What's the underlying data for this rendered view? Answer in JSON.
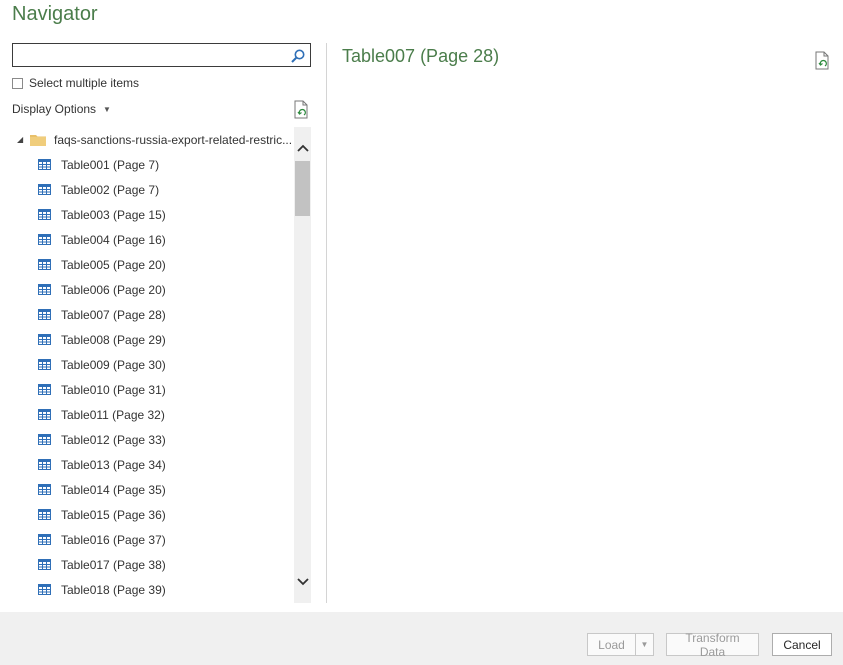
{
  "window": {
    "title": "Navigator"
  },
  "search": {
    "value": "",
    "placeholder": ""
  },
  "options": {
    "select_multiple_label": "Select multiple items",
    "select_multiple_checked": false,
    "display_options_label": "Display Options"
  },
  "tree": {
    "folder_label": "faqs-sanctions-russia-export-related-restric...",
    "items": [
      {
        "label": "Table001 (Page 7)"
      },
      {
        "label": "Table002 (Page 7)"
      },
      {
        "label": "Table003 (Page 15)"
      },
      {
        "label": "Table004 (Page 16)"
      },
      {
        "label": "Table005 (Page 20)"
      },
      {
        "label": "Table006 (Page 20)"
      },
      {
        "label": "Table007 (Page 28)"
      },
      {
        "label": "Table008 (Page 29)"
      },
      {
        "label": "Table009 (Page 30)"
      },
      {
        "label": "Table010 (Page 31)"
      },
      {
        "label": "Table011 (Page 32)"
      },
      {
        "label": "Table012 (Page 33)"
      },
      {
        "label": "Table013 (Page 34)"
      },
      {
        "label": "Table014 (Page 35)"
      },
      {
        "label": "Table015 (Page 36)"
      },
      {
        "label": "Table016 (Page 37)"
      },
      {
        "label": "Table017 (Page 38)"
      },
      {
        "label": "Table018 (Page 39)"
      }
    ]
  },
  "preview": {
    "title": "Table007 (Page 28)"
  },
  "footer": {
    "load_label": "Load",
    "transform_label": "Transform Data",
    "cancel_label": "Cancel"
  },
  "colors": {
    "accent_green": "#4b7d4b",
    "table_icon_blue": "#2f6fb7",
    "folder_yellow": "#e8c06a"
  },
  "icons": {
    "search": "search-icon",
    "refresh": "refresh-icon",
    "folder": "folder-icon",
    "table": "table-icon"
  }
}
